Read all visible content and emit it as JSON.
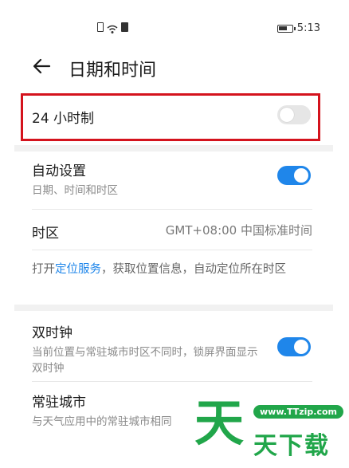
{
  "status_bar": {
    "time": "5:13"
  },
  "header": {
    "title": "日期和时间"
  },
  "settings": {
    "hour24": {
      "label": "24 小时制",
      "enabled": false
    },
    "auto": {
      "label": "自动设置",
      "sub": "日期、时间和时区",
      "enabled": true
    },
    "timezone": {
      "label": "时区",
      "value": "GMT+08:00 中国标准时间"
    },
    "location_note": {
      "prefix": "打开",
      "link": "定位服务",
      "suffix": "，获取位置信息，自动定位所在时区"
    },
    "dual_clock": {
      "label": "双时钟",
      "sub": "当前位置与常驻城市时区不同时，锁屏界面显示双时钟",
      "enabled": true
    },
    "home_city": {
      "label": "常驻城市",
      "sub": "与天气应用中的常驻城市相同"
    }
  },
  "watermark": {
    "site": "www.TTzip.com",
    "char": "天",
    "text": "天下载"
  },
  "colors": {
    "accent": "#1f86ea",
    "highlight": "#d4131d",
    "watermark": "#21a64a"
  }
}
